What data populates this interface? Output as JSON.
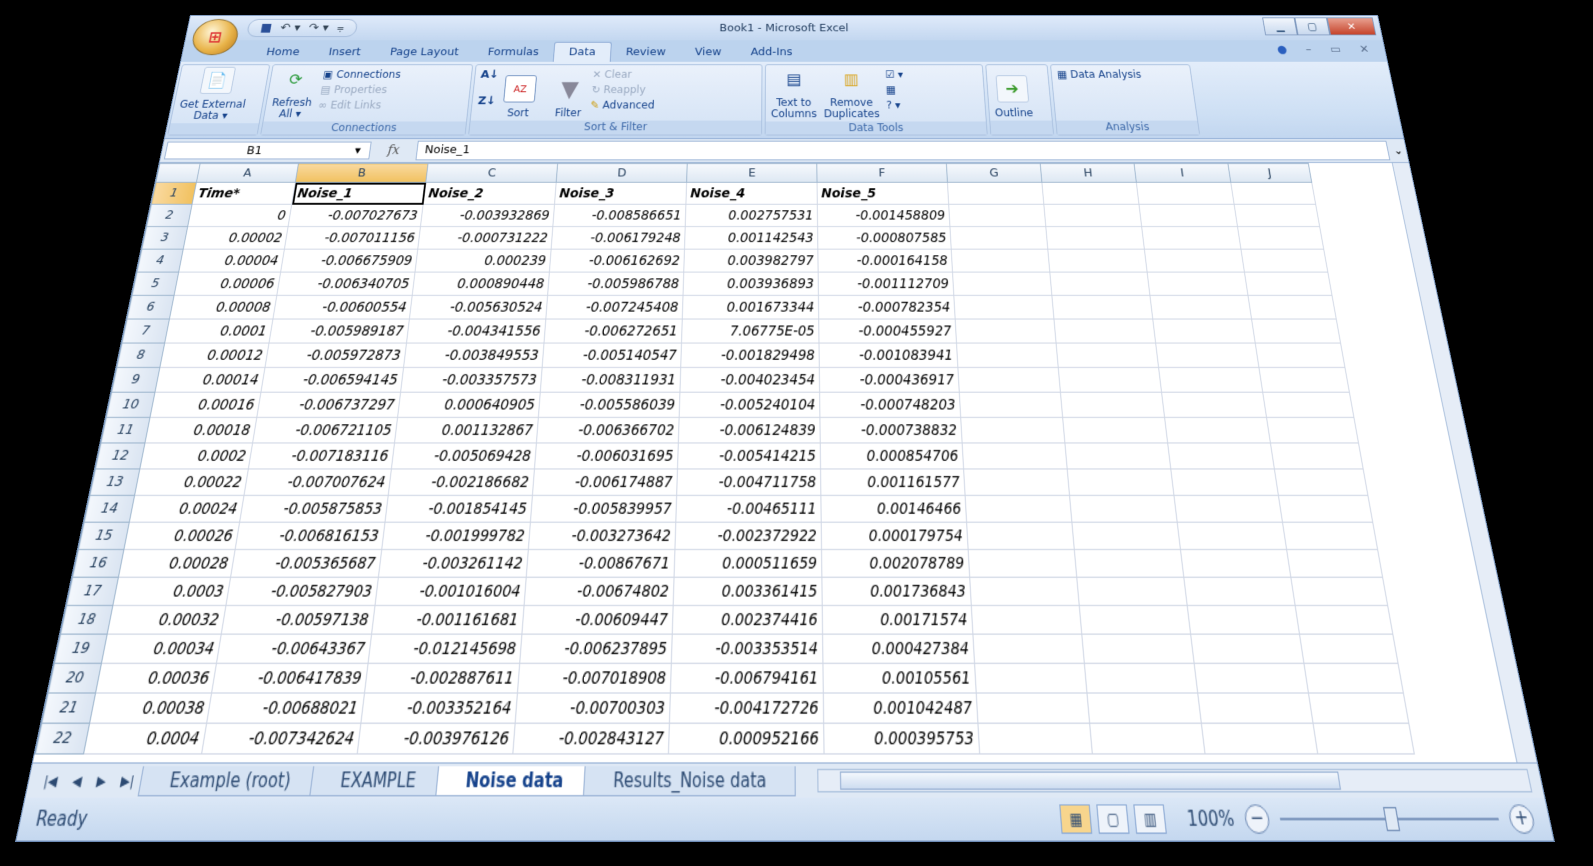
{
  "window": {
    "title": "Book1 - Microsoft Excel"
  },
  "qat": {
    "icons": [
      "save-icon",
      "undo-icon",
      "redo-icon",
      "customize-icon"
    ]
  },
  "tabs": [
    "Home",
    "Insert",
    "Page Layout",
    "Formulas",
    "Data",
    "Review",
    "View",
    "Add-Ins"
  ],
  "active_tab": "Data",
  "ribbon": {
    "get_external": "Get External\nData ▾",
    "refresh": "Refresh\nAll ▾",
    "connections": "Connections",
    "properties": "Properties",
    "edit_links": "Edit Links",
    "connections_group": "Connections",
    "sort_label": "Sort",
    "filter_label": "Filter",
    "clear": "Clear",
    "reapply": "Reapply",
    "advanced": "Advanced",
    "sort_filter_group": "Sort & Filter",
    "text_to_columns": "Text to\nColumns",
    "remove_duplicates": "Remove\nDuplicates",
    "data_tools_group": "Data Tools",
    "outline": "Outline",
    "data_analysis": "Data Analysis",
    "analysis_group": "Analysis"
  },
  "formula_bar": {
    "name_box": "B1",
    "fx": "fx",
    "value": "Noise_1"
  },
  "columns": [
    "A",
    "B",
    "C",
    "D",
    "E",
    "F",
    "G",
    "H",
    "I",
    "J"
  ],
  "selected_cell": "B1",
  "rows": [
    [
      "Time*",
      "Noise_1",
      "Noise_2",
      "Noise_3",
      "Noise_4",
      "Noise_5"
    ],
    [
      "0",
      "-0.007027673",
      "-0.003932869",
      "-0.008586651",
      "0.002757531",
      "-0.001458809"
    ],
    [
      "0.00002",
      "-0.007011156",
      "-0.000731222",
      "-0.006179248",
      "0.001142543",
      "-0.000807585"
    ],
    [
      "0.00004",
      "-0.006675909",
      "0.000239",
      "-0.006162692",
      "0.003982797",
      "-0.000164158"
    ],
    [
      "0.00006",
      "-0.006340705",
      "0.000890448",
      "-0.005986788",
      "0.003936893",
      "-0.001112709"
    ],
    [
      "0.00008",
      "-0.00600554",
      "-0.005630524",
      "-0.007245408",
      "0.001673344",
      "-0.000782354"
    ],
    [
      "0.0001",
      "-0.005989187",
      "-0.004341556",
      "-0.006272651",
      "7.06775E-05",
      "-0.000455927"
    ],
    [
      "0.00012",
      "-0.005972873",
      "-0.003849553",
      "-0.005140547",
      "-0.001829498",
      "-0.001083941"
    ],
    [
      "0.00014",
      "-0.006594145",
      "-0.003357573",
      "-0.008311931",
      "-0.004023454",
      "-0.000436917"
    ],
    [
      "0.00016",
      "-0.006737297",
      "0.000640905",
      "-0.005586039",
      "-0.005240104",
      "-0.000748203"
    ],
    [
      "0.00018",
      "-0.006721105",
      "0.001132867",
      "-0.006366702",
      "-0.006124839",
      "-0.000738832"
    ],
    [
      "0.0002",
      "-0.007183116",
      "-0.005069428",
      "-0.006031695",
      "-0.005414215",
      "0.000854706"
    ],
    [
      "0.00022",
      "-0.007007624",
      "-0.002186682",
      "-0.006174887",
      "-0.004711758",
      "0.001161577"
    ],
    [
      "0.00024",
      "-0.005875853",
      "-0.001854145",
      "-0.005839957",
      "-0.00465111",
      "0.00146466"
    ],
    [
      "0.00026",
      "-0.006816153",
      "-0.001999782",
      "-0.003273642",
      "-0.002372922",
      "0.000179754"
    ],
    [
      "0.00028",
      "-0.005365687",
      "-0.003261142",
      "-0.00867671",
      "0.000511659",
      "0.002078789"
    ],
    [
      "0.0003",
      "-0.005827903",
      "-0.001016004",
      "-0.00674802",
      "0.003361415",
      "0.001736843"
    ],
    [
      "0.00032",
      "-0.00597138",
      "-0.001161681",
      "-0.00609447",
      "0.002374416",
      "0.00171574"
    ],
    [
      "0.00034",
      "-0.00643367",
      "-0.012145698",
      "-0.006237895",
      "-0.003353514",
      "0.000427384"
    ],
    [
      "0.00036",
      "-0.006417839",
      "-0.002887611",
      "-0.007018908",
      "-0.006794161",
      "0.00105561"
    ],
    [
      "0.00038",
      "-0.00688021",
      "-0.003352164",
      "-0.00700303",
      "-0.004172726",
      "0.001042487"
    ],
    [
      "0.0004",
      "-0.007342624",
      "-0.003976126",
      "-0.002843127",
      "0.000952166",
      "0.000395753"
    ]
  ],
  "sheets": [
    "Example (root)",
    "EXAMPLE",
    "Noise data",
    "Results_Noise data"
  ],
  "active_sheet": "Noise data",
  "status": {
    "text": "Ready",
    "zoom": "100%",
    "zoom_level_percent": 100
  }
}
